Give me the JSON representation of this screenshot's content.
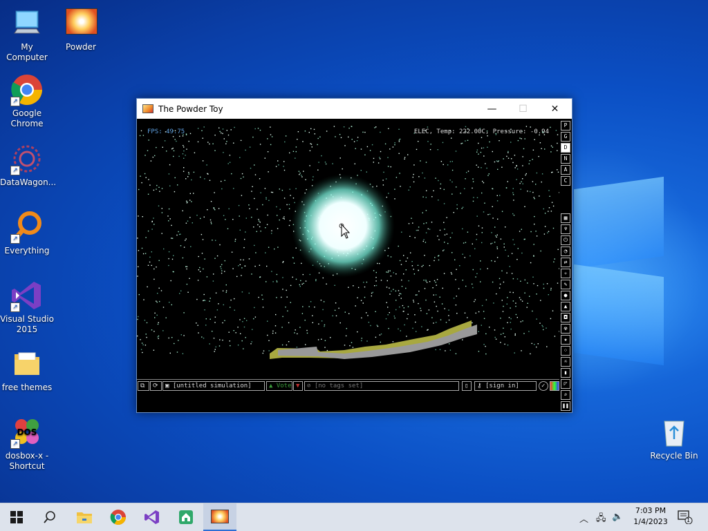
{
  "desktop": {
    "icons": [
      {
        "label": "My Computer"
      },
      {
        "label": "Powder"
      },
      {
        "label": "Google Chrome"
      },
      {
        "label": "DataWagon..."
      },
      {
        "label": "Everything"
      },
      {
        "label": "Visual Studio 2015"
      },
      {
        "label": "free themes"
      },
      {
        "label": "dosbox-x - Shortcut"
      },
      {
        "label": "Recycle Bin"
      }
    ]
  },
  "window": {
    "title": "The Powder Toy",
    "fps": "FPS: 49.75",
    "hud": "ELEC, Temp: 222.00C, Pressure: -0.94",
    "right_buttons": [
      "P",
      "G",
      "D",
      "N",
      "A",
      "C"
    ],
    "elements": [
      {
        "label": "POLO",
        "bg": "#a0a0a0",
        "fg": "#000000"
      },
      {
        "label": "GRVT",
        "bg": "#30c030",
        "fg": "#000000"
      },
      {
        "label": "PROT",
        "bg": "#c01818",
        "fg": "#ffffff"
      },
      {
        "label": "BVBR",
        "bg": "#303030",
        "fg": "#ffffff"
      },
      {
        "label": "VIBR",
        "bg": "#1a4a1a",
        "fg": "#ffffff"
      },
      {
        "label": "EXOT",
        "bg": "#3050d0",
        "fg": "#ffffff"
      },
      {
        "label": "ELEC",
        "bg": "#e0e8ff",
        "fg": "#000000"
      },
      {
        "label": "SING",
        "bg": "#000000",
        "fg": "#ffffff"
      },
      {
        "label": "ISZS",
        "bg": "#8030c0",
        "fg": "#ffffff"
      },
      {
        "label": "ISOZ",
        "bg": "#a030c0",
        "fg": "#ffffff"
      },
      {
        "label": "WARP",
        "bg": "#000000",
        "fg": "#ffffff"
      },
      {
        "label": "DEUT",
        "bg": "#10205a",
        "fg": "#ffffff"
      },
      {
        "label": "AMTR",
        "bg": "#909090",
        "fg": "#000000"
      },
      {
        "label": "URAN",
        "bg": "#606020",
        "fg": "#000000"
      },
      {
        "label": "PHOT",
        "bg": "#ffffff",
        "fg": "#000000"
      },
      {
        "label": "PLUT",
        "bg": "#30a030",
        "fg": "#000000"
      },
      {
        "label": "NEUT",
        "bg": "#20a0c0",
        "fg": "#ffffff"
      }
    ],
    "bottom": {
      "sim_name": "[untitled simulation]",
      "vote": "Vote",
      "tags": "[no tags set]",
      "sign_in": "[sign in]"
    }
  },
  "taskbar": {
    "time": "7:03 PM",
    "date": "1/4/2023",
    "notification_count": "1"
  },
  "colors": {
    "accent": "#2c6ed5",
    "selected_element_border": "#ff3030"
  }
}
